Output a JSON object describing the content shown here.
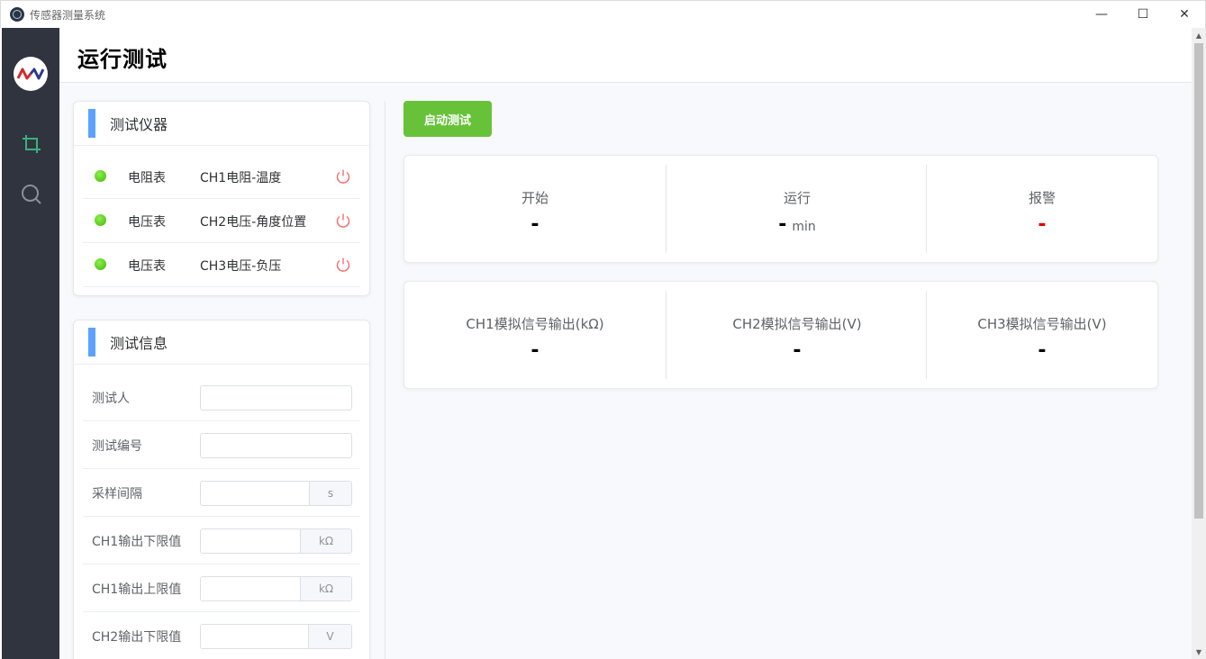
{
  "window": {
    "title": "传感器测量系统",
    "minimize": "—",
    "maximize": "☐",
    "close": "✕"
  },
  "sidebar": {
    "logo": "logo-icon",
    "items": [
      {
        "icon": "crop-icon",
        "active": true,
        "color": "#3bb07a"
      },
      {
        "icon": "search-icon",
        "active": false,
        "color": "#8a8f99"
      }
    ]
  },
  "header": {
    "title": "运行测试"
  },
  "instruments": {
    "title": "测试仪器",
    "rows": [
      {
        "type": "电阻表",
        "channel": "CH1电阻-温度",
        "status": "green"
      },
      {
        "type": "电压表",
        "channel": "CH2电压-角度位置",
        "status": "green"
      },
      {
        "type": "电压表",
        "channel": "CH3电压-负压",
        "status": "green"
      }
    ]
  },
  "test_info": {
    "title": "测试信息",
    "fields": [
      {
        "label": "测试人",
        "value": "",
        "unit": ""
      },
      {
        "label": "测试编号",
        "value": "",
        "unit": ""
      },
      {
        "label": "采样间隔",
        "value": "",
        "unit": "s"
      },
      {
        "label": "CH1输出下限值",
        "value": "",
        "unit": "kΩ"
      },
      {
        "label": "CH1输出上限值",
        "value": "",
        "unit": "kΩ"
      },
      {
        "label": "CH2输出下限值",
        "value": "",
        "unit": "V"
      }
    ]
  },
  "controls": {
    "start_label": "启动测试"
  },
  "status_card": {
    "items": [
      {
        "label": "开始",
        "value": "-",
        "unit": ""
      },
      {
        "label": "运行",
        "value": "-",
        "unit": "min"
      },
      {
        "label": "报警",
        "value": "-",
        "unit": "",
        "color": "#e00000"
      }
    ]
  },
  "signal_card": {
    "items": [
      {
        "label": "CH1模拟信号输出(kΩ)",
        "value": "-"
      },
      {
        "label": "CH2模拟信号输出(V)",
        "value": "-"
      },
      {
        "label": "CH3模拟信号输出(V)",
        "value": "-"
      }
    ]
  },
  "colors": {
    "sidebar_bg": "#30343f",
    "accent_blue": "#5aa2ff",
    "start_green": "#67c23a",
    "power_red": "#f56c6c",
    "alarm_red": "#e00000"
  }
}
